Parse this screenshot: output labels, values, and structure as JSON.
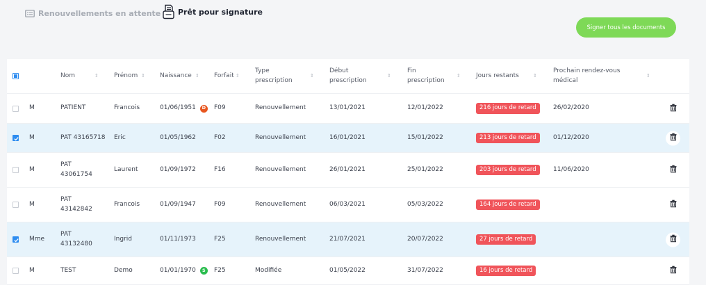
{
  "tabs": {
    "pending_renewals": "Renouvellements en attente",
    "ready_for_signature": "Prêt pour signature"
  },
  "sign_all_button": "Signer tous les documents",
  "colors": {
    "accent_green": "#7ed957",
    "late_badge": "#f0545a",
    "selected_row": "#e6f3fb",
    "checkbox_blue": "#2d8cf0",
    "dot_d": "#e8561f",
    "dot_s": "#2bbd4f"
  },
  "table": {
    "headers": {
      "nom": "Nom",
      "prenom": "Prénom",
      "naissance": "Naissance",
      "forfait": "Forfait",
      "type_line1": "Type",
      "type_line2": "prescription",
      "debut_line1": "Début",
      "debut_line2": "prescription",
      "fin_line1": "Fin",
      "fin_line2": "prescription",
      "jours": "Jours restants",
      "rdv_line1": "Prochain rendez-vous",
      "rdv_line2": "médical"
    },
    "rows": [
      {
        "selected": false,
        "civ": "M",
        "nom1": "PATIENT",
        "nom2": "",
        "prenom": "Francois",
        "naissance": "01/06/1951",
        "dot": "D",
        "forfait": "F09",
        "type": "Renouvellement",
        "debut": "13/01/2021",
        "fin": "12/01/2022",
        "jours": "216 jours de retard",
        "rdv": "26/02/2020"
      },
      {
        "selected": true,
        "civ": "M",
        "nom1": "PAT 43165718",
        "nom2": "",
        "prenom": "Eric",
        "naissance": "01/05/1962",
        "dot": "",
        "forfait": "F02",
        "type": "Renouvellement",
        "debut": "16/01/2021",
        "fin": "15/01/2022",
        "jours": "213 jours de retard",
        "rdv": "01/12/2020"
      },
      {
        "selected": false,
        "civ": "M",
        "nom1": "PAT",
        "nom2": "43061754",
        "prenom": "Laurent",
        "naissance": "01/09/1972",
        "dot": "",
        "forfait": "F16",
        "type": "Renouvellement",
        "debut": "26/01/2021",
        "fin": "25/01/2022",
        "jours": "203 jours de retard",
        "rdv": "11/06/2020"
      },
      {
        "selected": false,
        "civ": "M",
        "nom1": "PAT",
        "nom2": "43142842",
        "prenom": "Francois",
        "naissance": "01/09/1947",
        "dot": "",
        "forfait": "F09",
        "type": "Renouvellement",
        "debut": "06/03/2021",
        "fin": "05/03/2022",
        "jours": "164 jours de retard",
        "rdv": ""
      },
      {
        "selected": true,
        "civ": "Mme",
        "nom1": "PAT",
        "nom2": "43132480",
        "prenom": "Ingrid",
        "naissance": "01/11/1973",
        "dot": "",
        "forfait": "F25",
        "type": "Renouvellement",
        "debut": "21/07/2021",
        "fin": "20/07/2022",
        "jours": "27 jours de retard",
        "rdv": ""
      },
      {
        "selected": false,
        "civ": "M",
        "nom1": "TEST",
        "nom2": "",
        "prenom": "Demo",
        "naissance": "01/01/1970",
        "dot": "S",
        "forfait": "F25",
        "type": "Modifiée",
        "debut": "01/05/2022",
        "fin": "31/07/2022",
        "jours": "16 jours de retard",
        "rdv": ""
      }
    ]
  }
}
